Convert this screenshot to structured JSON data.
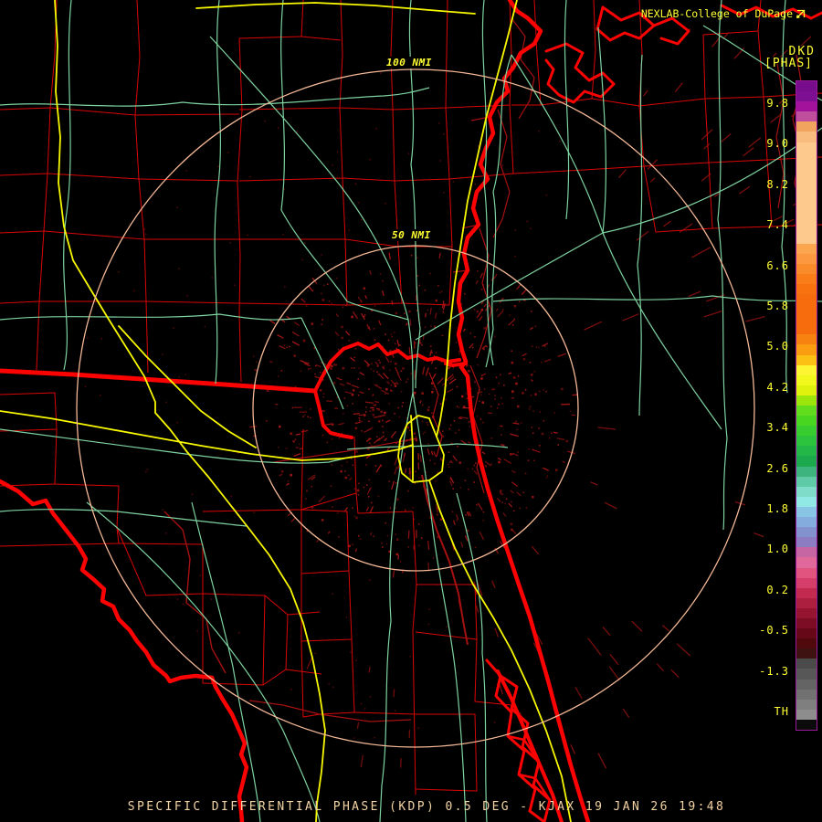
{
  "header": {
    "brand": "NEXLAB-College of DuPage",
    "logo_icon": "dupage-logo-icon",
    "product_code": "DKD",
    "units_label": "[PHAS]"
  },
  "rings": {
    "outer_label": "100 NMI",
    "inner_label": "50 NMI"
  },
  "footer": {
    "status_line": "SPECIFIC DIFFERENTIAL PHASE (KDP) 0.5 DEG - KJAX 19 JAN 26 19:48"
  },
  "scale": {
    "tick_labels": [
      "9.8",
      "9.0",
      "8.2",
      "7.4",
      "6.6",
      "5.8",
      "5.0",
      "4.2",
      "3.4",
      "2.6",
      "1.8",
      "1.0",
      "0.2",
      "-0.5",
      "-1.3",
      "TH"
    ],
    "colors": [
      "#770d8c",
      "#7d0f93",
      "#a2129b",
      "#bf4f9c",
      "#f0a45e",
      "#f8bc7e",
      "#fdc98d",
      "#fdc98d",
      "#fdc98d",
      "#fdc98d",
      "#fdc98d",
      "#fdc98d",
      "#fdc98d",
      "#fdc98d",
      "#fdc98d",
      "#fdc98d",
      "#fca54f",
      "#fb9840",
      "#fa8b2b",
      "#f97d19",
      "#f87310",
      "#f76c0c",
      "#f76c0c",
      "#f76c0c",
      "#f76c0c",
      "#f8820f",
      "#fa9d11",
      "#fcbf13",
      "#fdf432",
      "#f2f81c",
      "#dff20d",
      "#9ce60c",
      "#62dd1e",
      "#48d621",
      "#38cd2e",
      "#2bc43c",
      "#22b746",
      "#1ca94e",
      "#3db37e",
      "#5ecaa6",
      "#7fdcc8",
      "#90e9e4",
      "#88c4e4",
      "#84acdc",
      "#8292ce",
      "#8c7cc2",
      "#c667a4",
      "#e0689a",
      "#e25480",
      "#d43e68",
      "#c22a50",
      "#ad1f3e",
      "#951530",
      "#7d0d24",
      "#660818",
      "#500a0e",
      "#3e1210",
      "#4a4a4a",
      "#575757",
      "#646464",
      "#717171",
      "#7f7f7f",
      "#8d8d8d",
      "#0b0b0b"
    ]
  },
  "colors": {
    "txt_yellow": "#ffff33",
    "txt_tan": "#f3d3a3",
    "ring": "#f4b896",
    "county": "#d90606",
    "coast": "#fb0303",
    "marsh": "#a51111",
    "road_green": "#7ed3a0",
    "road_yellow": "#f8f800",
    "speckle": "#8a1010",
    "bar_border": "#9b1a9b"
  }
}
